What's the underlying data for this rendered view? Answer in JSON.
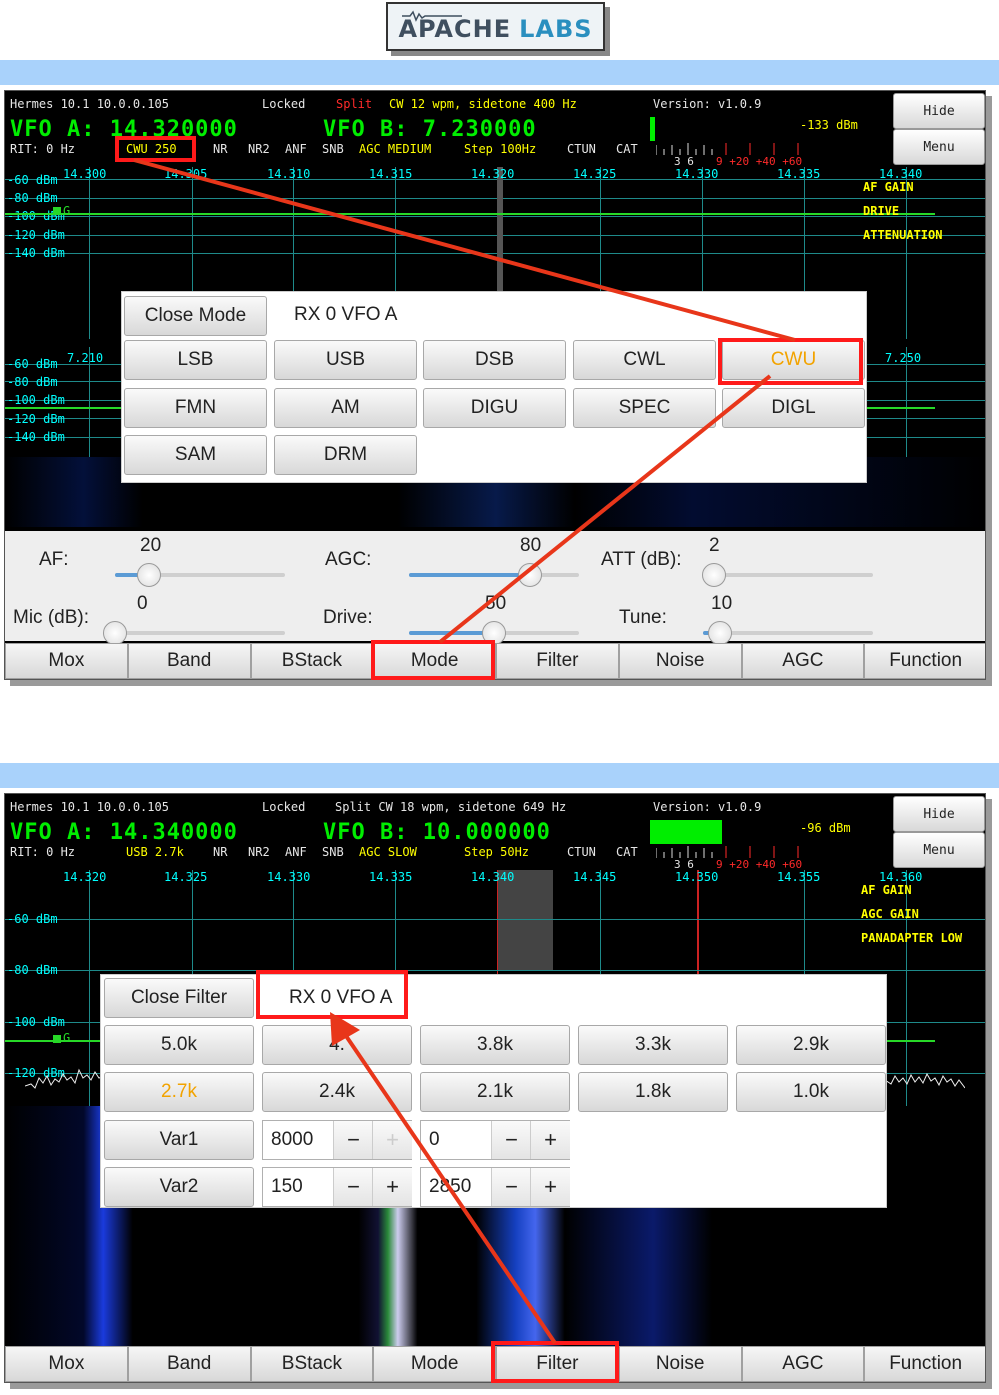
{
  "logo": {
    "brand": "APACHE",
    "suffix": "LABS"
  },
  "screen1": {
    "info": {
      "radio": "Hermes 10.1 10.0.0.105",
      "locked": "Locked",
      "split": "Split",
      "cw": "CW 12 wpm, sidetone 400 Hz",
      "version": "Version: v1.0.9"
    },
    "vfo_a": "VFO A: 14.320000",
    "vfo_b": "VFO B: 7.230000",
    "status": {
      "rit": "RIT: 0 Hz",
      "mode": "CWU 250",
      "nr": "NR",
      "nr2": "NR2",
      "anf": "ANF",
      "snb": "SNB",
      "agc": "AGC MEDIUM",
      "step": "Step 100Hz",
      "ctun": "CTUN",
      "cat": "CAT"
    },
    "smeter": {
      "level_text": "-133 dBm",
      "scale_white": "3 6",
      "scale_red": "9 +20 +40 +60",
      "fill_fraction": 0.02
    },
    "buttons": {
      "hide": "Hide",
      "menu": "Menu"
    },
    "pan1": {
      "freqs": [
        "14.300",
        "14.305",
        "14.310",
        "14.315",
        "14.320",
        "14.325",
        "14.330",
        "14.335",
        "14.340"
      ],
      "dbm": [
        "-60 dBm",
        "-80 dBm",
        "-100 dBm",
        "-120 dBm",
        "-140 dBm"
      ],
      "right_labels": [
        "AF GAIN",
        "DRIVE",
        "ATTENUATION"
      ],
      "marker": "G"
    },
    "pan2": {
      "freq_left": "7.210",
      "freq_right": "7.250",
      "dbm": [
        "-60 dBm",
        "-80 dBm",
        "-100 dBm",
        "-120 dBm",
        "-140 dBm"
      ]
    },
    "mode_panel": {
      "close": "Close Mode",
      "title": "RX 0 VFO A",
      "rows": [
        [
          "LSB",
          "USB",
          "DSB",
          "CWL",
          "CWU"
        ],
        [
          "FMN",
          "AM",
          "DIGU",
          "SPEC",
          "DIGL"
        ],
        [
          "SAM",
          "DRM"
        ]
      ],
      "selected": "CWU",
      "selected_color": "#f2a300"
    },
    "controls": {
      "af": {
        "label": "AF:",
        "value": "20"
      },
      "agc": {
        "label": "AGC:",
        "value": "80"
      },
      "att": {
        "label": "ATT (dB):",
        "value": "2"
      },
      "mic": {
        "label": "Mic (dB):",
        "value": "0"
      },
      "drive": {
        "label": "Drive:",
        "value": "50"
      },
      "tune": {
        "label": "Tune:",
        "value": "10"
      }
    },
    "bottom": [
      "Mox",
      "Band",
      "BStack",
      "Mode",
      "Filter",
      "Noise",
      "AGC",
      "Function"
    ]
  },
  "screen2": {
    "info": {
      "radio": "Hermes 10.1 10.0.0.105",
      "locked": "Locked",
      "split": "Split CW 18 wpm, sidetone 649 Hz",
      "version": "Version: v1.0.9"
    },
    "vfo_a": "VFO A: 14.340000",
    "vfo_b": "VFO B: 10.000000",
    "status": {
      "rit": "RIT: 0 Hz",
      "mode": "USB 2.7k",
      "nr": "NR",
      "nr2": "NR2",
      "anf": "ANF",
      "snb": "SNB",
      "agc": "AGC SLOW",
      "step": "Step 50Hz",
      "ctun": "CTUN",
      "cat": "CAT"
    },
    "smeter": {
      "level_text": "-96 dBm",
      "scale_white": "3 6",
      "scale_red": "9 +20 +40 +60",
      "fill_fraction": 0.3
    },
    "buttons": {
      "hide": "Hide",
      "menu": "Menu"
    },
    "pan": {
      "freqs": [
        "14.320",
        "14.325",
        "14.330",
        "14.335",
        "14.340",
        "14.345",
        "14.350",
        "14.355",
        "14.360"
      ],
      "dbm": [
        "-60 dBm",
        "-80 dBm",
        "-100 dBm",
        "-120 dBm"
      ],
      "right_labels": [
        "AF GAIN",
        "AGC GAIN",
        "PANADAPTER LOW"
      ],
      "marker": "G"
    },
    "filter_panel": {
      "close": "Close Filter",
      "title": "RX 0 VFO A",
      "rows": [
        [
          "5.0k",
          "4.",
          "3.8k",
          "3.3k",
          "2.9k"
        ],
        [
          "2.7k",
          "2.4k",
          "2.1k",
          "1.8k",
          "1.0k"
        ]
      ],
      "selected": "2.7k",
      "var1": {
        "label": "Var1",
        "low": "8000",
        "high": "0"
      },
      "var2": {
        "label": "Var2",
        "low": "150",
        "high": "2850"
      },
      "minus": "−",
      "plus": "+"
    },
    "bottom": [
      "Mox",
      "Band",
      "BStack",
      "Mode",
      "Filter",
      "Noise",
      "AGC",
      "Function"
    ]
  },
  "colors": {
    "highlight": "#ff1a1a",
    "vfo": "#00ee00",
    "scale": "#00ffff",
    "labels": "#ffff00",
    "bar": "#a9d2fb"
  }
}
